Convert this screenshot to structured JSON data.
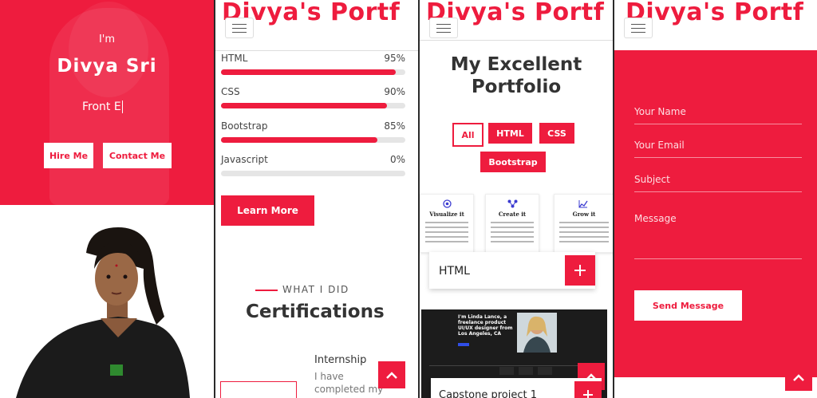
{
  "hero": {
    "greeting": "I'm",
    "name": "Divya Sri",
    "typed_text": "Front E",
    "hire_button": "Hire Me",
    "contact_button": "Contact Me"
  },
  "brand": "Divya's Portf",
  "skills": [
    {
      "label": "HTML",
      "percent_text": "95%",
      "level": 0.95
    },
    {
      "label": "CSS",
      "percent_text": "90%",
      "level": 0.9
    },
    {
      "label": "Bootstrap",
      "percent_text": "85%",
      "level": 0.85
    },
    {
      "label": "Javascript",
      "percent_text": "0%",
      "level": 0.0
    }
  ],
  "learn_more": "Learn More",
  "what_i_did": "WHAT I DID",
  "certifications_title": "Certifications",
  "internship": {
    "title": "Internship",
    "text_line1": "I have",
    "text_line2": "completed my"
  },
  "portfolio": {
    "title_line1": "My Excellent",
    "title_line2": "Portfolio",
    "filters": [
      "All",
      "HTML",
      "CSS",
      "Bootstrap"
    ],
    "cards": [
      {
        "title": "Visualize it"
      },
      {
        "title": "Create it"
      },
      {
        "title": "Grow it"
      }
    ],
    "overlay1": "HTML",
    "project_hero_line1": "I'm Linda Lance, a",
    "project_hero_line2": "freelance product",
    "project_hero_line3": "UI/UX designer from",
    "project_hero_line4": "Los Angeles, CA",
    "overlay2": "Capstone project 1"
  },
  "contact_form": {
    "name_placeholder": "Your Name",
    "email_placeholder": "Your Email",
    "subject_placeholder": "Subject",
    "message_placeholder": "Message",
    "send_button": "Send Message"
  },
  "colors": {
    "accent": "#ee1c3e",
    "text_dark": "#333333"
  }
}
